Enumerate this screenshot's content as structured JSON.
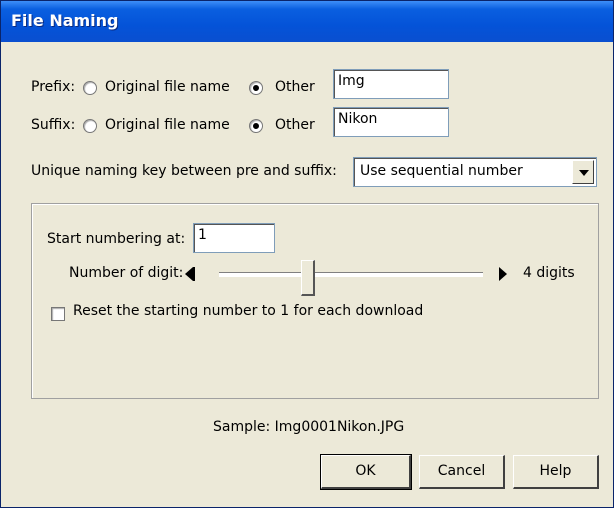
{
  "window": {
    "title": "File Naming"
  },
  "prefix": {
    "label": "Prefix:",
    "option_original": "Original file name",
    "option_other": "Other",
    "selected": "Other",
    "value": "Img"
  },
  "suffix": {
    "label": "Suffix:",
    "option_original": "Original file name",
    "option_other": "Other",
    "selected": "Other",
    "value": "Nikon"
  },
  "unique_key": {
    "label": "Unique naming key between pre and suffix:",
    "selected": "Use sequential number"
  },
  "numbering": {
    "start_label": "Start numbering at:",
    "start_value": "1",
    "digits_label": "Number of digit:",
    "digits_value_text": "4 digits",
    "digits_value": 4,
    "reset_label": "Reset the starting number to 1 for each download",
    "reset_checked": false
  },
  "sample": {
    "text": "Sample: Img0001Nikon.JPG"
  },
  "buttons": {
    "ok": "OK",
    "cancel": "Cancel",
    "help": "Help"
  }
}
